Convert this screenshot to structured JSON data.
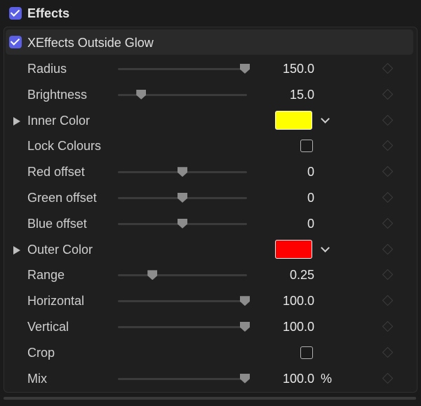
{
  "section": {
    "title": "Effects",
    "enabled": true
  },
  "effect": {
    "name": "XEffects Outside Glow",
    "enabled": true
  },
  "params": [
    {
      "label": "Radius",
      "kind": "slider",
      "value": "150.0",
      "fraction": 1.0
    },
    {
      "label": "Brightness",
      "kind": "slider",
      "value": "15.0",
      "fraction": 0.17
    },
    {
      "label": "Inner Color",
      "kind": "color",
      "color": "#ffff00"
    },
    {
      "label": "Lock Colours",
      "kind": "checkbox",
      "checked": false
    },
    {
      "label": "Red offset",
      "kind": "slider",
      "value": "0",
      "fraction": 0.5
    },
    {
      "label": "Green offset",
      "kind": "slider",
      "value": "0",
      "fraction": 0.5
    },
    {
      "label": "Blue offset",
      "kind": "slider",
      "value": "0",
      "fraction": 0.5
    },
    {
      "label": "Outer Color",
      "kind": "color",
      "color": "#ff0000"
    },
    {
      "label": "Range",
      "kind": "slider",
      "value": "0.25",
      "fraction": 0.26
    },
    {
      "label": "Horizontal",
      "kind": "slider",
      "value": "100.0",
      "fraction": 1.0
    },
    {
      "label": "Vertical",
      "kind": "slider",
      "value": "100.0",
      "fraction": 1.0
    },
    {
      "label": "Crop",
      "kind": "checkbox",
      "checked": false
    },
    {
      "label": "Mix",
      "kind": "slider",
      "value": "100.0",
      "unit": "%",
      "fraction": 1.0
    }
  ],
  "colors": {
    "accent": "#5b5fe6",
    "background": "#1b1b1b"
  }
}
